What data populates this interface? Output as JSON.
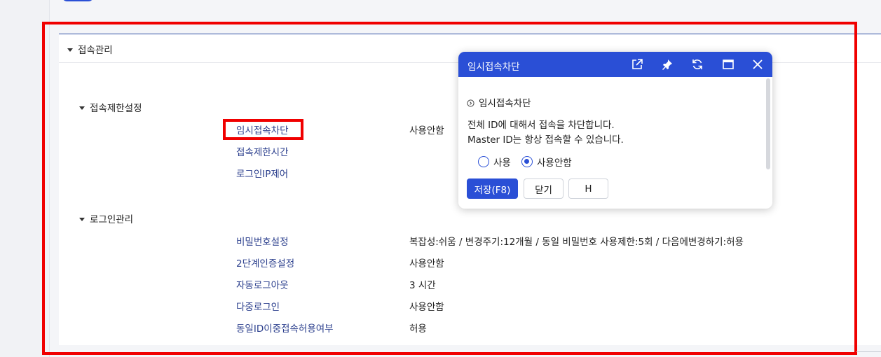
{
  "section_header": "접속관리",
  "access_restriction": {
    "title": "접속제한설정",
    "items": [
      {
        "label": "임시접속차단",
        "value": "사용안함"
      },
      {
        "label": "접속제한시간",
        "value": ""
      },
      {
        "label": "로그인IP제어",
        "value": ""
      }
    ]
  },
  "login_management": {
    "title": "로그인관리",
    "items": [
      {
        "label": "비밀번호설정",
        "value": "복잡성:쉬움 / 변경주기:12개월 / 동일 비밀번호 사용제한:5회 / 다음에변경하기:허용"
      },
      {
        "label": "2단계인증설정",
        "value": "사용안함"
      },
      {
        "label": "자동로그아웃",
        "value": "3 시간"
      },
      {
        "label": "다중로그인",
        "value": "사용안함"
      },
      {
        "label": "동일ID이중접속허용여부",
        "value": "허용"
      }
    ]
  },
  "popup": {
    "title": "임시접속차단",
    "header_icons": [
      "external-link-icon",
      "pin-icon",
      "refresh-icon",
      "maximize-icon",
      "close-icon"
    ],
    "info_title": "임시접속차단",
    "description_line1": "전체 ID에 대해서 접속을 차단합니다.",
    "description_line2": "Master ID는 항상 접속할 수 있습니다.",
    "options": [
      "사용",
      "사용안함"
    ],
    "selected_option": "사용안함",
    "buttons": {
      "save": "저장(F8)",
      "close": "닫기",
      "h": "H"
    }
  },
  "colors": {
    "accent": "#2a4fd6",
    "link": "#2b3f8d",
    "highlight": "#f00000"
  }
}
